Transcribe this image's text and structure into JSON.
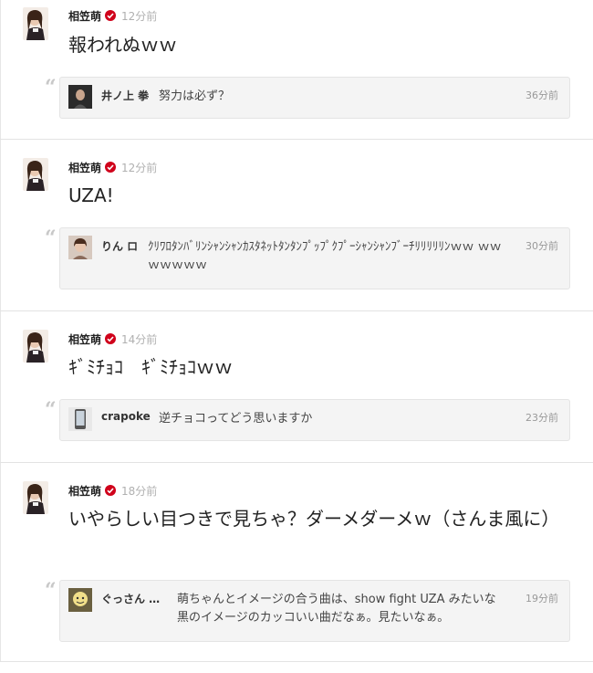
{
  "posts": [
    {
      "author": "相笠萌",
      "time": "12分前",
      "message": "報われぬｗｗ",
      "reply": {
        "name": "井ノ上 拳",
        "text": "努力は必ず？",
        "time": "36分前"
      }
    },
    {
      "author": "相笠萌",
      "time": "12分前",
      "message": "UZA!",
      "reply": {
        "name": "りん ロ",
        "text": "ｸﾘﾜﾛﾀﾝﾊﾞﾘﾝｼｬﾝｼｬﾝｶｽﾀﾈｯﾄﾀﾝﾀﾝﾌﾟｯﾌﾟｸﾌﾟｰｼｬﾝｼｬﾝﾌﾞｰﾁﾘﾘﾘﾘﾘﾝｗｗ ｗｗｗｗｗｗｗ",
        "time": "30分前"
      }
    },
    {
      "author": "相笠萌",
      "time": "14分前",
      "message": "ｷﾞﾐﾁｮｺ　ｷﾞﾐﾁｮｺｗｗ",
      "reply": {
        "name": "crapoke",
        "text": "逆チョコってどう思いますか",
        "time": "23分前"
      }
    },
    {
      "author": "相笠萌",
      "time": "18分前",
      "message": "いやらしい目つきで見ちゃ？ダーメダーメｗ（さんま風に）",
      "reply": {
        "name": "ぐっさん …",
        "text": "萌ちゃんとイメージの合う曲は、show fight UZA みたいな黒のイメージのカッコいい曲だなぁ。見たいなぁ。",
        "time": "19分前"
      }
    }
  ],
  "colors": {
    "verified": "#d0021b",
    "reply_bg": "#f4f4f4",
    "time": "#b0b0b0"
  },
  "icons": {
    "verified": "verified-check-icon",
    "quote": "quote-icon"
  }
}
